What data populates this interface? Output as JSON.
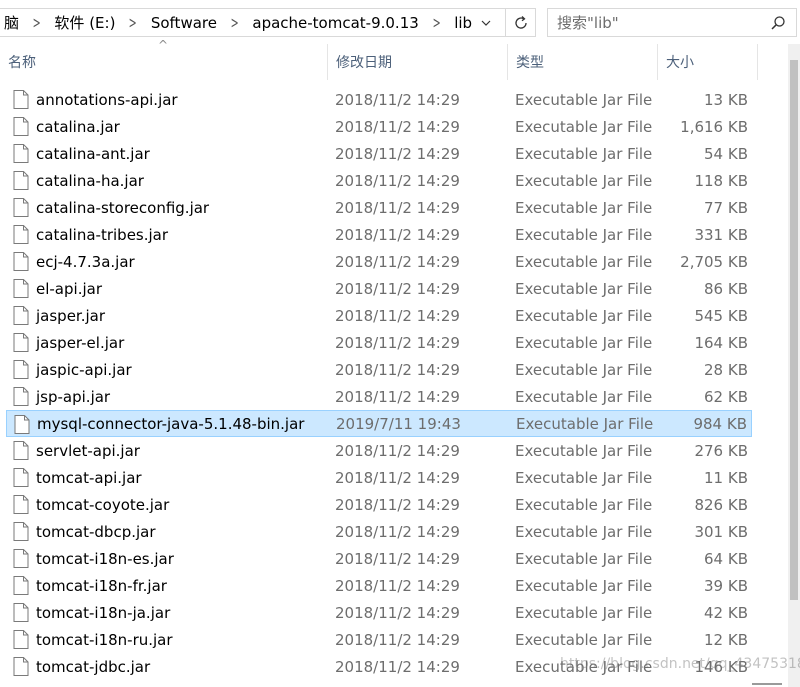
{
  "breadcrumb": {
    "items": [
      "脑",
      "软件 (E:)",
      "Software",
      "apache-tomcat-9.0.13",
      "lib"
    ]
  },
  "search": {
    "placeholder": "搜索\"lib\""
  },
  "columns": {
    "name": "名称",
    "date": "修改日期",
    "type": "类型",
    "size": "大小"
  },
  "files": [
    {
      "name": "annotations-api.jar",
      "date": "2018/11/2 14:29",
      "type": "Executable Jar File",
      "size": "13 KB"
    },
    {
      "name": "catalina.jar",
      "date": "2018/11/2 14:29",
      "type": "Executable Jar File",
      "size": "1,616 KB"
    },
    {
      "name": "catalina-ant.jar",
      "date": "2018/11/2 14:29",
      "type": "Executable Jar File",
      "size": "54 KB"
    },
    {
      "name": "catalina-ha.jar",
      "date": "2018/11/2 14:29",
      "type": "Executable Jar File",
      "size": "118 KB"
    },
    {
      "name": "catalina-storeconfig.jar",
      "date": "2018/11/2 14:29",
      "type": "Executable Jar File",
      "size": "77 KB"
    },
    {
      "name": "catalina-tribes.jar",
      "date": "2018/11/2 14:29",
      "type": "Executable Jar File",
      "size": "331 KB"
    },
    {
      "name": "ecj-4.7.3a.jar",
      "date": "2018/11/2 14:29",
      "type": "Executable Jar File",
      "size": "2,705 KB"
    },
    {
      "name": "el-api.jar",
      "date": "2018/11/2 14:29",
      "type": "Executable Jar File",
      "size": "86 KB"
    },
    {
      "name": "jasper.jar",
      "date": "2018/11/2 14:29",
      "type": "Executable Jar File",
      "size": "545 KB"
    },
    {
      "name": "jasper-el.jar",
      "date": "2018/11/2 14:29",
      "type": "Executable Jar File",
      "size": "164 KB"
    },
    {
      "name": "jaspic-api.jar",
      "date": "2018/11/2 14:29",
      "type": "Executable Jar File",
      "size": "28 KB"
    },
    {
      "name": "jsp-api.jar",
      "date": "2018/11/2 14:29",
      "type": "Executable Jar File",
      "size": "62 KB"
    },
    {
      "name": "mysql-connector-java-5.1.48-bin.jar",
      "date": "2019/7/11 19:43",
      "type": "Executable Jar File",
      "size": "984 KB",
      "selected": true
    },
    {
      "name": "servlet-api.jar",
      "date": "2018/11/2 14:29",
      "type": "Executable Jar File",
      "size": "276 KB"
    },
    {
      "name": "tomcat-api.jar",
      "date": "2018/11/2 14:29",
      "type": "Executable Jar File",
      "size": "11 KB"
    },
    {
      "name": "tomcat-coyote.jar",
      "date": "2018/11/2 14:29",
      "type": "Executable Jar File",
      "size": "826 KB"
    },
    {
      "name": "tomcat-dbcp.jar",
      "date": "2018/11/2 14:29",
      "type": "Executable Jar File",
      "size": "301 KB"
    },
    {
      "name": "tomcat-i18n-es.jar",
      "date": "2018/11/2 14:29",
      "type": "Executable Jar File",
      "size": "64 KB"
    },
    {
      "name": "tomcat-i18n-fr.jar",
      "date": "2018/11/2 14:29",
      "type": "Executable Jar File",
      "size": "39 KB"
    },
    {
      "name": "tomcat-i18n-ja.jar",
      "date": "2018/11/2 14:29",
      "type": "Executable Jar File",
      "size": "42 KB"
    },
    {
      "name": "tomcat-i18n-ru.jar",
      "date": "2018/11/2 14:29",
      "type": "Executable Jar File",
      "size": "12 KB"
    },
    {
      "name": "tomcat-jdbc.jar",
      "date": "2018/11/2 14:29",
      "type": "Executable Jar File",
      "size": "146 KB"
    }
  ],
  "watermark": "https://blog.csdn.net/qq_43475318",
  "colors": {
    "selection": "#cce8ff",
    "selection_border": "#99d1ff",
    "header_text": "#4c607a"
  }
}
